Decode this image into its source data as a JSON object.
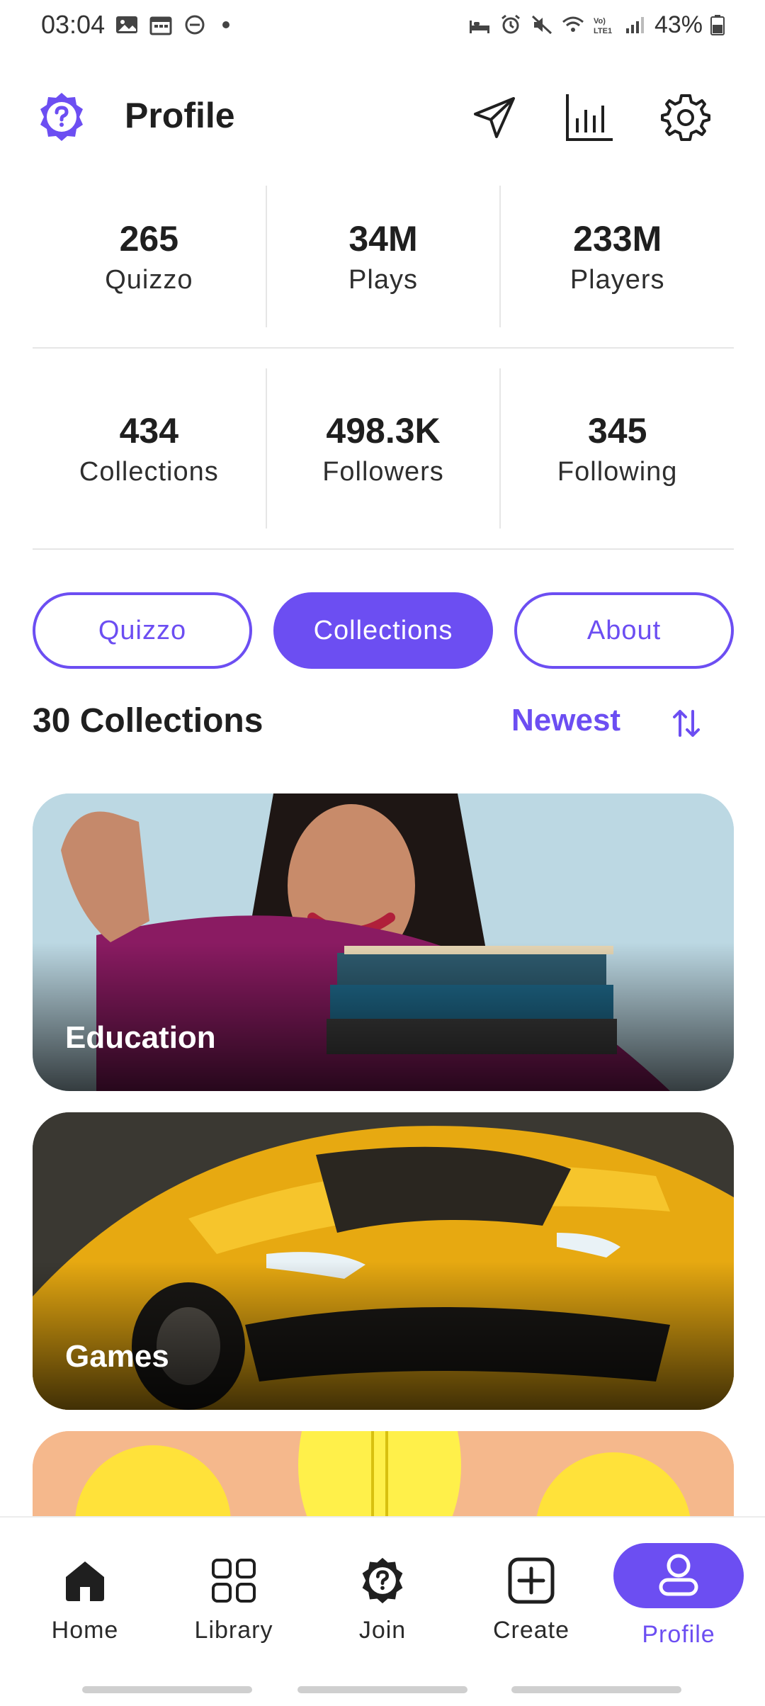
{
  "status_bar": {
    "time": "03:04",
    "battery": "43%"
  },
  "header": {
    "title": "Profile"
  },
  "stats_row1": [
    {
      "value": "265",
      "label": "Quizzo"
    },
    {
      "value": "34M",
      "label": "Plays"
    },
    {
      "value": "233M",
      "label": "Players"
    }
  ],
  "stats_row2": [
    {
      "value": "434",
      "label": "Collections"
    },
    {
      "value": "498.3K",
      "label": "Followers"
    },
    {
      "value": "345",
      "label": "Following"
    }
  ],
  "tabs": [
    {
      "label": "Quizzo",
      "active": false
    },
    {
      "label": "Collections",
      "active": true
    },
    {
      "label": "About",
      "active": false
    }
  ],
  "list": {
    "title": "30 Collections",
    "sort_label": "Newest"
  },
  "cards": [
    {
      "caption": "Education"
    },
    {
      "caption": "Games"
    },
    {
      "caption": ""
    }
  ],
  "bottom_nav": [
    {
      "label": "Home",
      "icon": "home-icon",
      "active": false
    },
    {
      "label": "Library",
      "icon": "grid-icon",
      "active": false
    },
    {
      "label": "Join",
      "icon": "join-icon",
      "active": false
    },
    {
      "label": "Create",
      "icon": "plus-square-icon",
      "active": false
    },
    {
      "label": "Profile",
      "icon": "person-icon",
      "active": true
    }
  ],
  "colors": {
    "accent": "#6c4ef2",
    "text": "#1f1f1f",
    "divider": "#e6e6e6"
  }
}
